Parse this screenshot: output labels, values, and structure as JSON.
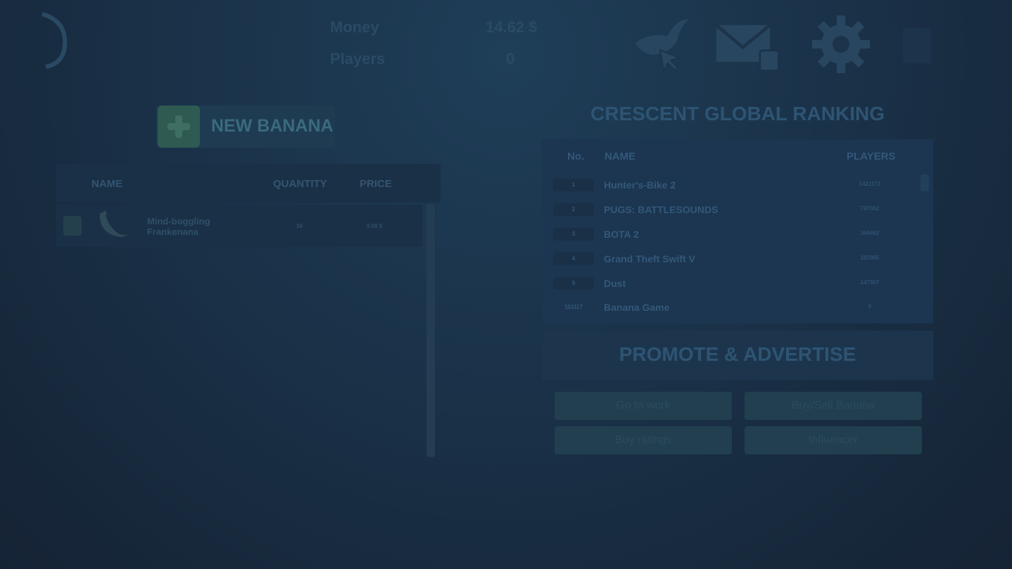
{
  "header": {
    "money_label": "Money",
    "money_value": "14.62 $",
    "players_label": "Players",
    "players_value": "0",
    "icons": [
      "bird-cursor-icon",
      "mail-icon",
      "gear-icon"
    ]
  },
  "inventory": {
    "new_button_label": "NEW BANANA",
    "columns": {
      "name": "NAME",
      "quantity": "QUANTITY",
      "price": "PRICE"
    },
    "items": [
      {
        "name_line1": "Mind-boggling",
        "name_line2": "Frankenana",
        "quantity": "10",
        "price": "0.08 $"
      }
    ]
  },
  "ranking": {
    "title": "CRESCENT GLOBAL RANKING",
    "columns": {
      "no": "No.",
      "name": "NAME",
      "players": "PLAYERS"
    },
    "rows": [
      {
        "no": "1",
        "name": "Hunter's-Bike 2",
        "players": "1421173"
      },
      {
        "no": "2",
        "name": "PUGS: BATTLESOUNDS",
        "players": "747062"
      },
      {
        "no": "3",
        "name": "BOTA 2",
        "players": "366462"
      },
      {
        "no": "4",
        "name": "Grand Theft Swift V",
        "players": "282985"
      },
      {
        "no": "5",
        "name": "Dust",
        "players": "247907"
      },
      {
        "no": "101117",
        "name": "Banana Game",
        "players": "0"
      }
    ]
  },
  "promote": {
    "title": "PROMOTE & ADVERTISE",
    "buttons": {
      "work": "Go to work",
      "buysell": "Buy/Sell Banana",
      "ratings": "Buy ratings",
      "influencer": "Influencer"
    }
  },
  "colors": {
    "background": "#1a3249",
    "accent_green": "#2e5a52"
  }
}
